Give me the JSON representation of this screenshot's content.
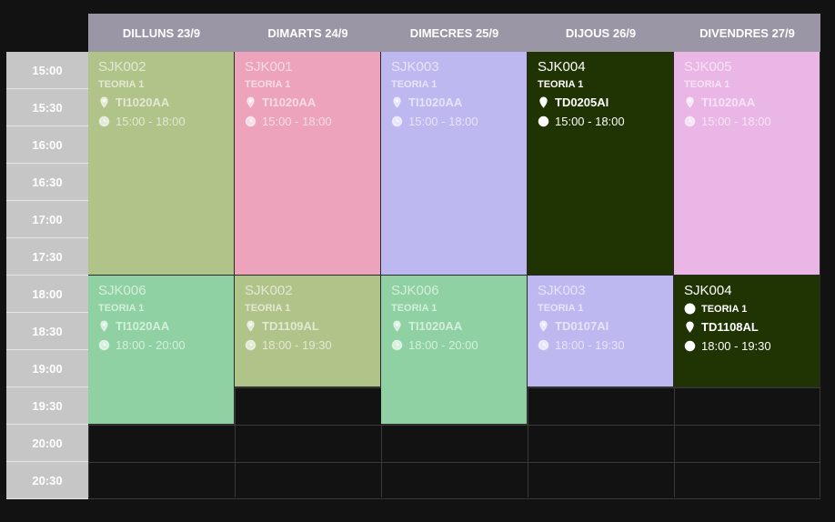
{
  "days": [
    {
      "label": "DILLUNS 23/9"
    },
    {
      "label": "DIMARTS 24/9"
    },
    {
      "label": "DIMECRES 25/9"
    },
    {
      "label": "DIJOUS 26/9"
    },
    {
      "label": "DIVENDRES 27/9"
    }
  ],
  "times": [
    "15:00",
    "15:30",
    "16:00",
    "16:30",
    "17:00",
    "17:30",
    "18:00",
    "18:30",
    "19:00",
    "19:30",
    "20:00",
    "20:30"
  ],
  "colors": {
    "green_olive": "#b0c48a",
    "pink": "#eca3bb",
    "lavender": "#bdb8f0",
    "dark_green": "#1f3303",
    "light_pink": "#eab6e6",
    "mint": "#8fd1a2",
    "header": "#9a96a6",
    "time": "#c6c6c6"
  },
  "events": [
    {
      "day": 0,
      "code": "SJK002",
      "type": "TEORIA 1",
      "room": "TI1020AA",
      "time": "15:00 - 18:00"
    },
    {
      "day": 1,
      "code": "SJK001",
      "type": "TEORIA 1",
      "room": "TI1020AA",
      "time": "15:00 - 18:00"
    },
    {
      "day": 2,
      "code": "SJK003",
      "type": "TEORIA 1",
      "room": "TI1020AA",
      "time": "15:00 - 18:00"
    },
    {
      "day": 3,
      "code": "SJK004",
      "type": "TEORIA 1",
      "room": "TD0205AI",
      "time": "15:00 - 18:00"
    },
    {
      "day": 4,
      "code": "SJK005",
      "type": "TEORIA 1",
      "room": "TI1020AA",
      "time": "15:00 - 18:00"
    },
    {
      "day": 0,
      "code": "SJK006",
      "type": "TEORIA 1",
      "room": "TI1020AA",
      "time": "18:00 - 20:00"
    },
    {
      "day": 1,
      "code": "SJK002",
      "type": "TEORIA 1",
      "room": "TD1109AL",
      "time": "18:00 - 19:30"
    },
    {
      "day": 2,
      "code": "SJK006",
      "type": "TEORIA 1",
      "room": "TI1020AA",
      "time": "18:00 - 20:00"
    },
    {
      "day": 3,
      "code": "SJK003",
      "type": "TEORIA 1",
      "room": "TD0107AI",
      "time": "18:00 - 19:30"
    },
    {
      "day": 4,
      "code": "SJK004",
      "type": "TEORIA 1",
      "room": "TD1108AL",
      "time": "18:00 - 19:30"
    }
  ]
}
